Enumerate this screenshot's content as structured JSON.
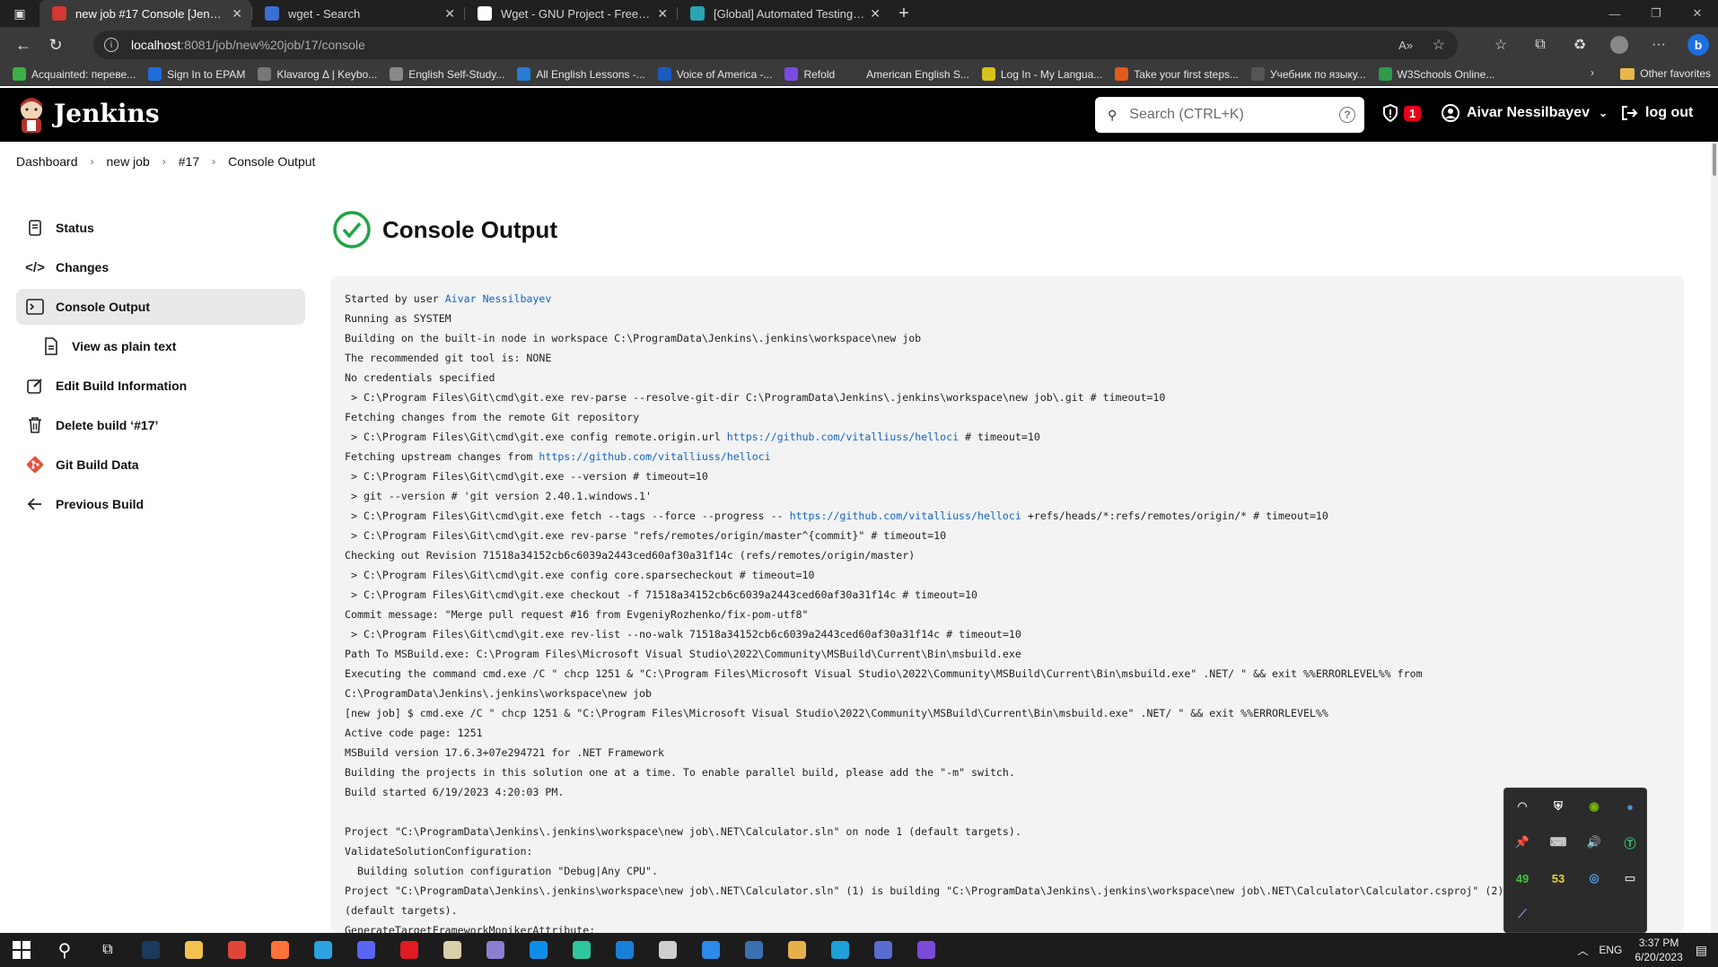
{
  "browser": {
    "tabs": [
      {
        "title": "new job #17 Console [Jenkins]",
        "color": "#d33833"
      },
      {
        "title": "wget - Search",
        "color": "#3b6fd4"
      },
      {
        "title": "Wget - GNU Project - Free Softw...",
        "color": "#ffffff"
      },
      {
        "title": "[Global] Automated Testing Fou...",
        "color": "#2aa3b3"
      }
    ],
    "url_host": "localhost",
    "url_rest": ":8081/job/new%20job/17/console",
    "bookmarks": [
      {
        "label": "Acquainted: переве...",
        "color": "#3fae49"
      },
      {
        "label": "Sign In to EPAM",
        "color": "#1e6fd9"
      },
      {
        "label": "Klavarog Δ | Keybo...",
        "color": "#777777"
      },
      {
        "label": "English Self-Study...",
        "color": "#888888"
      },
      {
        "label": "All English Lessons -...",
        "color": "#2a7bd4"
      },
      {
        "label": "Voice of America -...",
        "color": "#1a5bbf"
      },
      {
        "label": "Refold",
        "color": "#7a4be0"
      },
      {
        "label": "American English S...",
        "color": "#3a3a3a"
      },
      {
        "label": "Log In - My Langua...",
        "color": "#d8c21c"
      },
      {
        "label": "Take your first steps...",
        "color": "#e25b1c"
      },
      {
        "label": "Учебник по языку...",
        "color": "#555555"
      },
      {
        "label": "W3Schools Online...",
        "color": "#2e9a4a"
      }
    ],
    "other_favorites": "Other favorites"
  },
  "jenkins": {
    "title": "Jenkins",
    "search_placeholder": "Search (CTRL+K)",
    "security_count": "1",
    "user": "Aivar Nessilbayev",
    "logout": "log out"
  },
  "breadcrumb": [
    "Dashboard",
    "new job",
    "#17",
    "Console Output"
  ],
  "sidebar": [
    {
      "label": "Status",
      "icon": "status-icon"
    },
    {
      "label": "Changes",
      "icon": "code-icon"
    },
    {
      "label": "Console Output",
      "icon": "terminal-icon"
    },
    {
      "label": "View as plain text",
      "icon": "document-icon"
    },
    {
      "label": "Edit Build Information",
      "icon": "edit-icon"
    },
    {
      "label": "Delete build ‘#17’",
      "icon": "trash-icon"
    },
    {
      "label": "Git Build Data",
      "icon": "git-icon"
    },
    {
      "label": "Previous Build",
      "icon": "arrow-left-icon"
    }
  ],
  "page_title": "Console Output",
  "console": [
    [
      "Started by user ",
      {
        "link": "Aivar Nessilbayev"
      }
    ],
    [
      "Running as SYSTEM"
    ],
    [
      "Building on the built-in node in workspace C:\\ProgramData\\Jenkins\\.jenkins\\workspace\\new job"
    ],
    [
      "The recommended git tool is: NONE"
    ],
    [
      "No credentials specified"
    ],
    [
      " > C:\\Program Files\\Git\\cmd\\git.exe rev-parse --resolve-git-dir C:\\ProgramData\\Jenkins\\.jenkins\\workspace\\new job\\.git # timeout=10"
    ],
    [
      "Fetching changes from the remote Git repository"
    ],
    [
      " > C:\\Program Files\\Git\\cmd\\git.exe config remote.origin.url ",
      {
        "link": "https://github.com/vitalliuss/helloci"
      },
      " # timeout=10"
    ],
    [
      "Fetching upstream changes from ",
      {
        "link": "https://github.com/vitalliuss/helloci"
      }
    ],
    [
      " > C:\\Program Files\\Git\\cmd\\git.exe --version # timeout=10"
    ],
    [
      " > git --version # 'git version 2.40.1.windows.1'"
    ],
    [
      " > C:\\Program Files\\Git\\cmd\\git.exe fetch --tags --force --progress -- ",
      {
        "link": "https://github.com/vitalliuss/helloci"
      },
      " +refs/heads/*:refs/remotes/origin/* # timeout=10"
    ],
    [
      " > C:\\Program Files\\Git\\cmd\\git.exe rev-parse \"refs/remotes/origin/master^{commit}\" # timeout=10"
    ],
    [
      "Checking out Revision 71518a34152cb6c6039a2443ced60af30a31f14c (refs/remotes/origin/master)"
    ],
    [
      " > C:\\Program Files\\Git\\cmd\\git.exe config core.sparsecheckout # timeout=10"
    ],
    [
      " > C:\\Program Files\\Git\\cmd\\git.exe checkout -f 71518a34152cb6c6039a2443ced60af30a31f14c # timeout=10"
    ],
    [
      "Commit message: \"Merge pull request #16 from EvgeniyRozhenko/fix-pom-utf8\""
    ],
    [
      " > C:\\Program Files\\Git\\cmd\\git.exe rev-list --no-walk 71518a34152cb6c6039a2443ced60af30a31f14c # timeout=10"
    ],
    [
      "Path To MSBuild.exe: C:\\Program Files\\Microsoft Visual Studio\\2022\\Community\\MSBuild\\Current\\Bin\\msbuild.exe"
    ],
    [
      "Executing the command cmd.exe /C \" chcp 1251 & \"C:\\Program Files\\Microsoft Visual Studio\\2022\\Community\\MSBuild\\Current\\Bin\\msbuild.exe\" .NET/ \" && exit %%ERRORLEVEL%% from"
    ],
    [
      "C:\\ProgramData\\Jenkins\\.jenkins\\workspace\\new job"
    ],
    [
      "[new job] $ cmd.exe /C \" chcp 1251 & \"C:\\Program Files\\Microsoft Visual Studio\\2022\\Community\\MSBuild\\Current\\Bin\\msbuild.exe\" .NET/ \" && exit %%ERRORLEVEL%%"
    ],
    [
      "Active code page: 1251"
    ],
    [
      "MSBuild version 17.6.3+07e294721 for .NET Framework"
    ],
    [
      "Building the projects in this solution one at a time. To enable parallel build, please add the \"-m\" switch."
    ],
    [
      "Build started 6/19/2023 4:20:03 PM."
    ],
    [
      ""
    ],
    [
      "Project \"C:\\ProgramData\\Jenkins\\.jenkins\\workspace\\new job\\.NET\\Calculator.sln\" on node 1 (default targets)."
    ],
    [
      "ValidateSolutionConfiguration:"
    ],
    [
      "  Building solution configuration \"Debug|Any CPU\"."
    ],
    [
      "Project \"C:\\ProgramData\\Jenkins\\.jenkins\\workspace\\new job\\.NET\\Calculator.sln\" (1) is building \"C:\\ProgramData\\Jenkins\\.jenkins\\workspace\\new job\\.NET\\Calculator\\Calculator.csproj\" (2) on node 1"
    ],
    [
      "(default targets)."
    ],
    [
      "GenerateTargetFrameworkMonikerAttribute:"
    ]
  ],
  "tray": {
    "items": [
      "wifi-icon",
      "shield-icon",
      "nvidia-icon",
      "app-icon",
      "pin-icon",
      "keyboard-icon",
      "volume-icon",
      "t-icon",
      "49",
      "53",
      "browser-icon",
      "battery-icon",
      "feather-icon"
    ],
    "num1_color": "#3fc43f",
    "num2_color": "#e6d23a"
  },
  "taskbar": {
    "lang": "ENG",
    "time": "3:37 PM",
    "date": "6/20/2023"
  }
}
